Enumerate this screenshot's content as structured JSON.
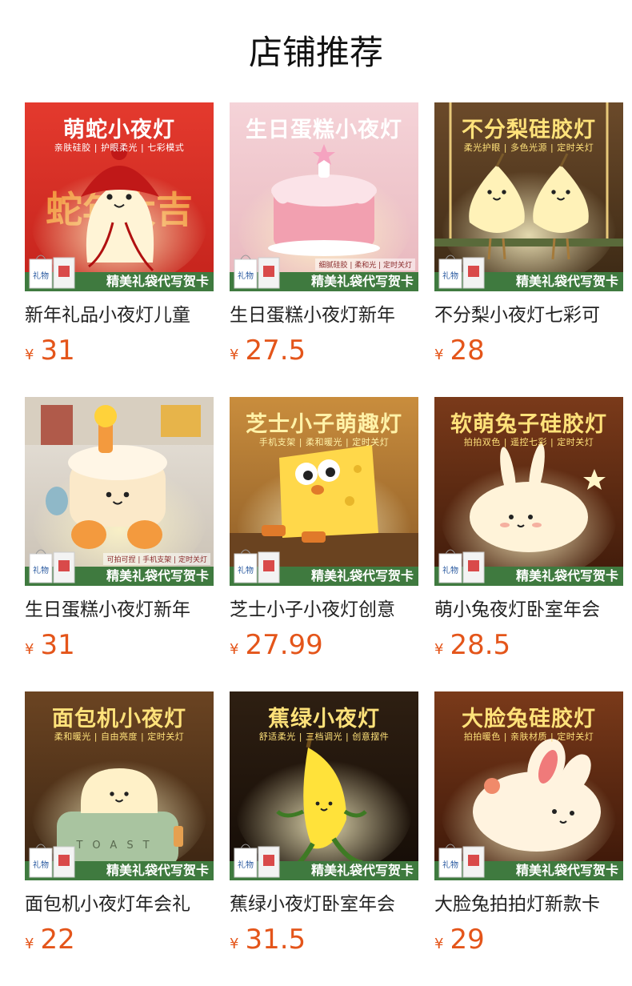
{
  "header": {
    "title": "店铺推荐"
  },
  "gift_bar_label": "精美礼袋代写贺卡",
  "gift_bag_text": "礼物",
  "currency_symbol": "¥",
  "products": [
    {
      "name": "新年礼品小夜灯儿童",
      "price": "31",
      "image": {
        "headline": "萌蛇小夜灯",
        "sub": "亲肤硅胶 | 护眼柔光 | 七彩模式",
        "tagline": "",
        "bg_top": "#e43a2e",
        "bg_bottom": "#c4231c",
        "headline_color": "#ffffff",
        "sub_color": "#ffffff",
        "figure": "snake",
        "figure_color": "#fff4d6",
        "accent": "#c01818",
        "bg_text": "蛇年大吉"
      }
    },
    {
      "name": "生日蛋糕小夜灯新年",
      "price": "27.5",
      "image": {
        "headline": "生日蛋糕小夜灯",
        "sub": "",
        "tagline": "细腻硅胶 | 柔和光 | 定时关灯",
        "bg_top": "#f5d3d8",
        "bg_bottom": "#e8b7bd",
        "headline_color": "#ffffff",
        "sub_color": "#ffffff",
        "figure": "cake",
        "figure_color": "#fbe3e8",
        "accent": "#f2a0b0",
        "bg_text": ""
      }
    },
    {
      "name": "不分梨小夜灯七彩可",
      "price": "28",
      "image": {
        "headline": "不分梨硅胶灯",
        "sub": "柔光护眼 | 多色光源 | 定时关灯",
        "tagline": "",
        "bg_top": "#6b4a2a",
        "bg_bottom": "#3a2814",
        "headline_color": "#ffe27a",
        "sub_color": "#ffe27a",
        "figure": "pears",
        "figure_color": "#fff2b8",
        "accent": "#e8c97a",
        "bg_text": ""
      }
    },
    {
      "name": "生日蛋糕小夜灯新年",
      "price": "31",
      "image": {
        "headline": "",
        "sub": "",
        "tagline": "可拍可捏 | 手机支架 | 定时关灯",
        "bg_top": "#e9e4dc",
        "bg_bottom": "#c9c0b3",
        "headline_color": "#ffffff",
        "sub_color": "#ffffff",
        "figure": "cakeguy",
        "figure_color": "#fbe9c9",
        "accent": "#f39a3e",
        "bg_text": ""
      }
    },
    {
      "name": "芝士小子小夜灯创意",
      "price": "27.99",
      "image": {
        "headline": "芝士小子萌趣灯",
        "sub": "手机支架 | 柔和暖光 | 定时关灯",
        "tagline": "",
        "bg_top": "#c98d3d",
        "bg_bottom": "#8a5a26",
        "headline_color": "#fff2a8",
        "sub_color": "#fff2a8",
        "figure": "cheese",
        "figure_color": "#ffd84a",
        "accent": "#e07a2a",
        "bg_text": ""
      }
    },
    {
      "name": "萌小兔夜灯卧室年会",
      "price": "28.5",
      "image": {
        "headline": "软萌兔子硅胶灯",
        "sub": "拍拍双色 | 遥控七彩 | 定时关灯",
        "tagline": "",
        "bg_top": "#7a3a1a",
        "bg_bottom": "#3e1a0a",
        "headline_color": "#ffe27a",
        "sub_color": "#ffe27a",
        "figure": "bunny",
        "figure_color": "#fff3d9",
        "accent": "#f5c07a",
        "bg_text": ""
      }
    },
    {
      "name": "面包机小夜灯年会礼",
      "price": "22",
      "image": {
        "headline": "面包机小夜灯",
        "sub": "柔和暖光 | 自由亮度 | 定时关灯",
        "tagline": "",
        "bg_top": "#6b4422",
        "bg_bottom": "#3a2412",
        "headline_color": "#ffe27a",
        "sub_color": "#ffe27a",
        "figure": "toaster",
        "figure_color": "#fff1c8",
        "accent": "#a9c4a0",
        "bg_text": "TOAST"
      }
    },
    {
      "name": "蕉绿小夜灯卧室年会",
      "price": "31.5",
      "image": {
        "headline": "蕉绿小夜灯",
        "sub": "舒适柔光 | 三档调光 | 创意摆件",
        "tagline": "",
        "bg_top": "#2e1f12",
        "bg_bottom": "#140c06",
        "headline_color": "#ffe27a",
        "sub_color": "#ffe27a",
        "figure": "banana",
        "figure_color": "#ffe23a",
        "accent": "#3e7a24",
        "bg_text": ""
      }
    },
    {
      "name": "大脸兔拍拍灯新款卡",
      "price": "29",
      "image": {
        "headline": "大脸兔硅胶灯",
        "sub": "拍拍暖色 | 亲肤材质 | 定时关灯",
        "tagline": "",
        "bg_top": "#7a3a1a",
        "bg_bottom": "#3a1608",
        "headline_color": "#ffe27a",
        "sub_color": "#ffe27a",
        "figure": "bigbunny",
        "figure_color": "#fff3df",
        "accent": "#f07a7a",
        "bg_text": ""
      }
    }
  ]
}
